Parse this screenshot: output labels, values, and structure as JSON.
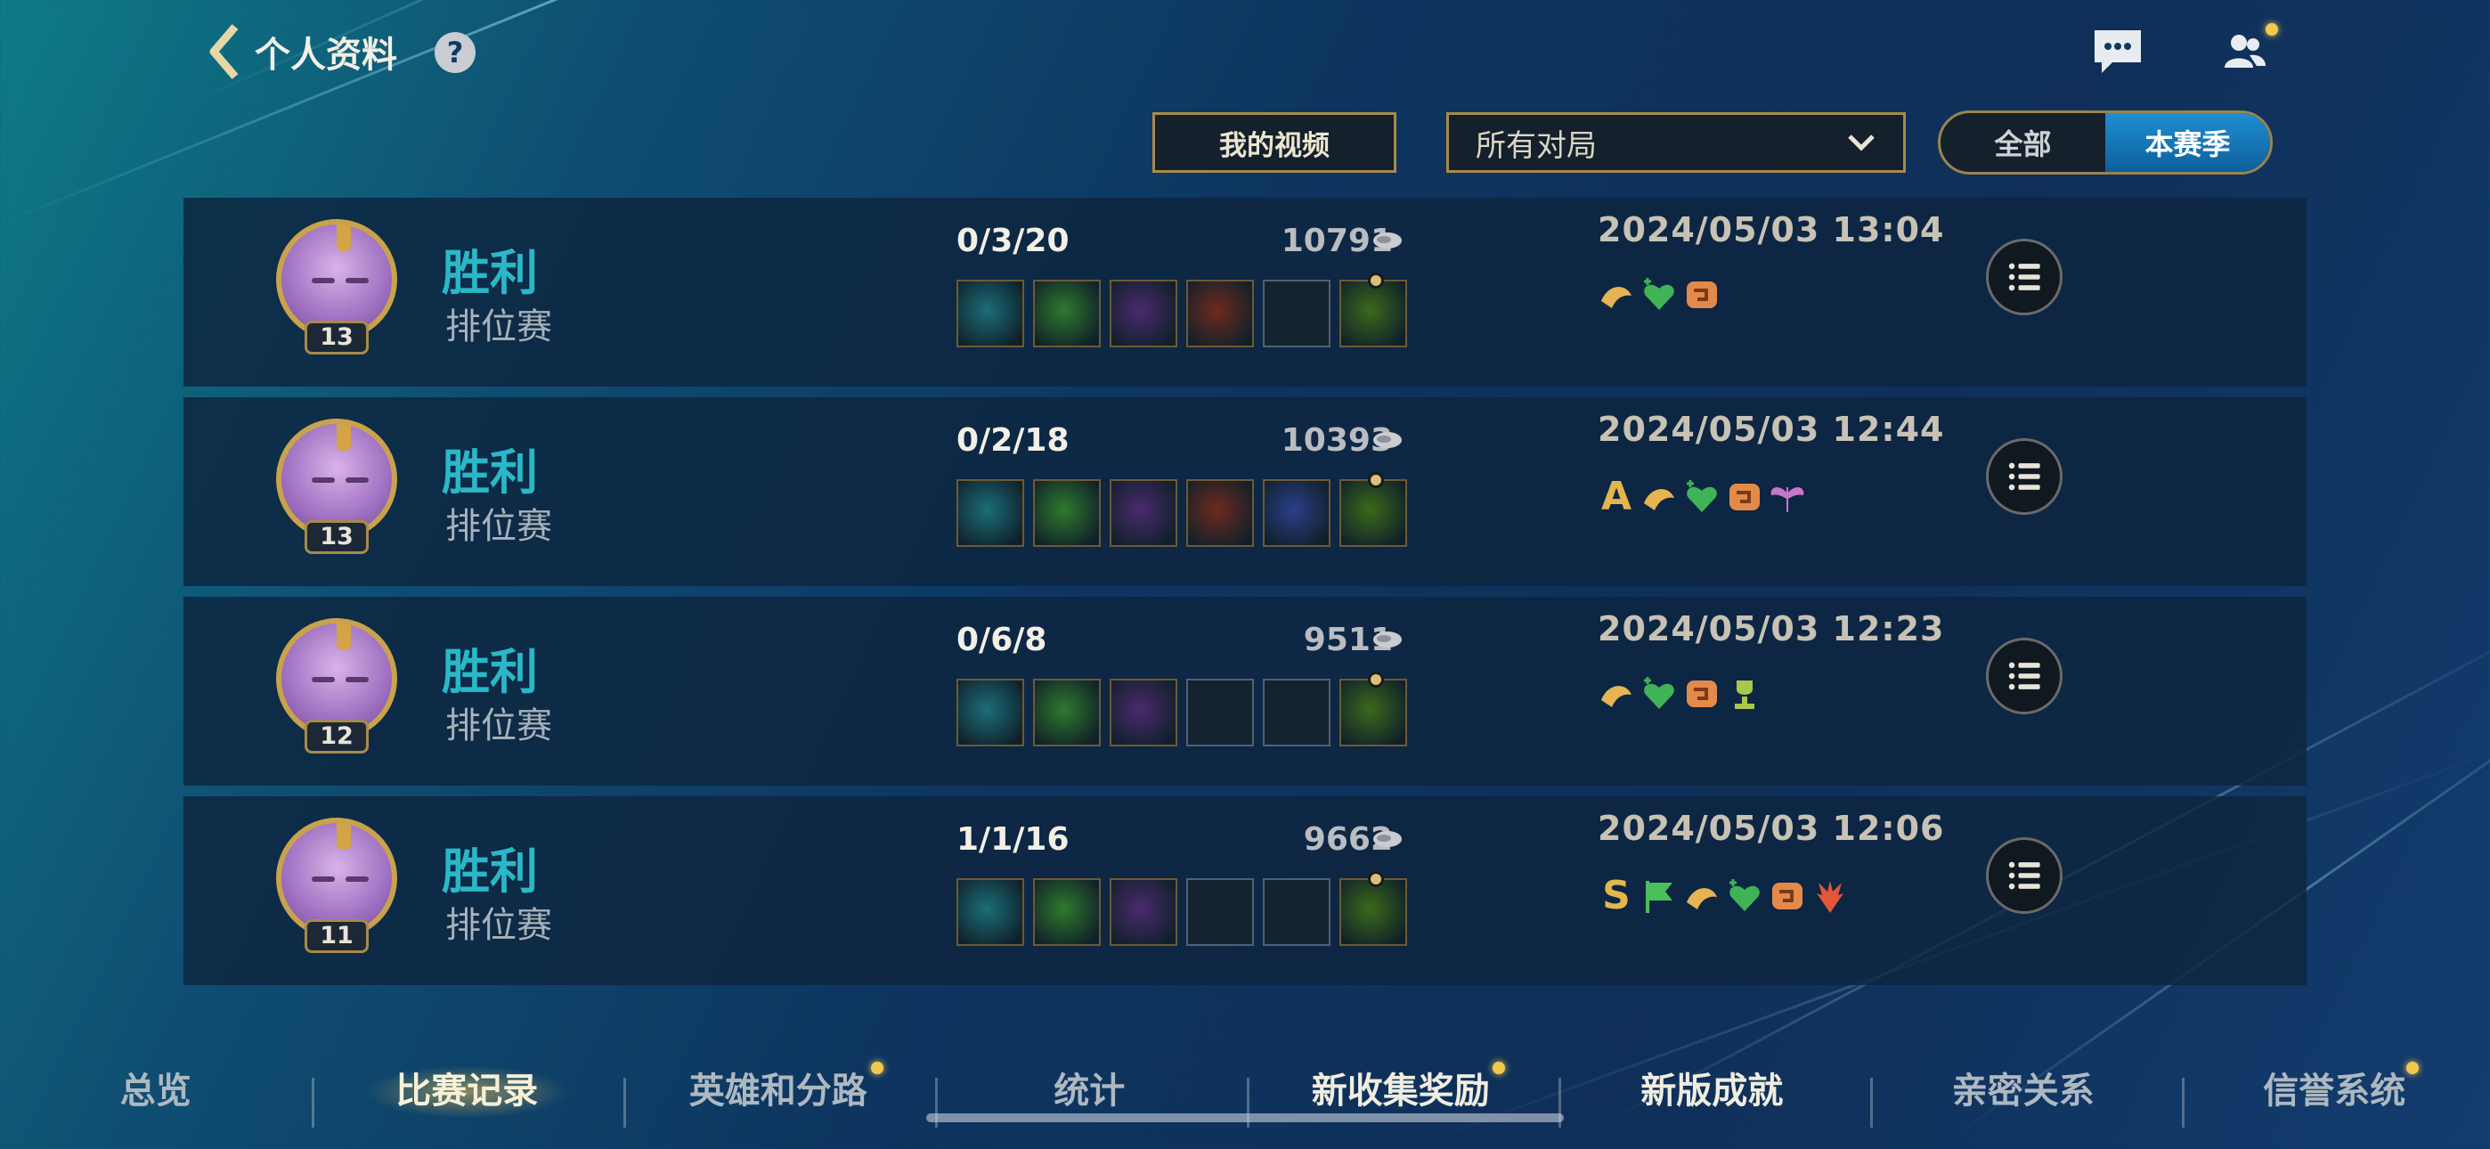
{
  "header": {
    "title": "个人资料",
    "help_label": "?"
  },
  "filters": {
    "video_button": "我的视频",
    "match_type_selected": "所有对局",
    "toggle_all": "全部",
    "toggle_season": "本赛季",
    "toggle_active": "本赛季"
  },
  "matches": [
    {
      "result": "胜利",
      "mode": "排位赛",
      "level": "13",
      "kda": "0/3/20",
      "gold": "10791",
      "date": "2024/05/03 13:04",
      "items_filled": [
        true,
        true,
        true,
        true,
        false,
        true
      ],
      "grade": "",
      "runes": [
        "bloom",
        "heart",
        "orange",
        ""
      ]
    },
    {
      "result": "胜利",
      "mode": "排位赛",
      "level": "13",
      "kda": "0/2/18",
      "gold": "10393",
      "date": "2024/05/03 12:44",
      "items_filled": [
        true,
        true,
        true,
        true,
        true,
        true
      ],
      "grade": "A",
      "runes": [
        "bloom",
        "heart",
        "orange",
        "wings"
      ]
    },
    {
      "result": "胜利",
      "mode": "排位赛",
      "level": "12",
      "kda": "0/6/8",
      "gold": "9511",
      "date": "2024/05/03 12:23",
      "items_filled": [
        true,
        true,
        true,
        false,
        false,
        true
      ],
      "grade": "",
      "runes": [
        "bloom",
        "heart",
        "orange",
        "trophy"
      ]
    },
    {
      "result": "胜利",
      "mode": "排位赛",
      "level": "11",
      "kda": "1/1/16",
      "gold": "9662",
      "date": "2024/05/03 12:06",
      "items_filled": [
        true,
        true,
        true,
        false,
        false,
        true
      ],
      "grade": "S",
      "runes": [
        "flag",
        "bloom",
        "heart",
        "orange",
        "demon"
      ]
    }
  ],
  "nav": {
    "tabs": [
      "总览",
      "比赛记录",
      "英雄和分路",
      "统计",
      "新收集奖励",
      "新版成就",
      "亲密关系",
      "信誉系统"
    ],
    "active": "比赛记录"
  },
  "colors": {
    "victory": "#2ab8c8",
    "gold_border": "#a88a4a",
    "active_toggle": "#1f8fd0",
    "notification": "#f2c94c"
  },
  "icons": [
    "back-chevron-icon",
    "help-icon",
    "chat-icon",
    "friends-icon",
    "gold-coin-icon",
    "list-icon",
    "chevron-down-icon"
  ]
}
